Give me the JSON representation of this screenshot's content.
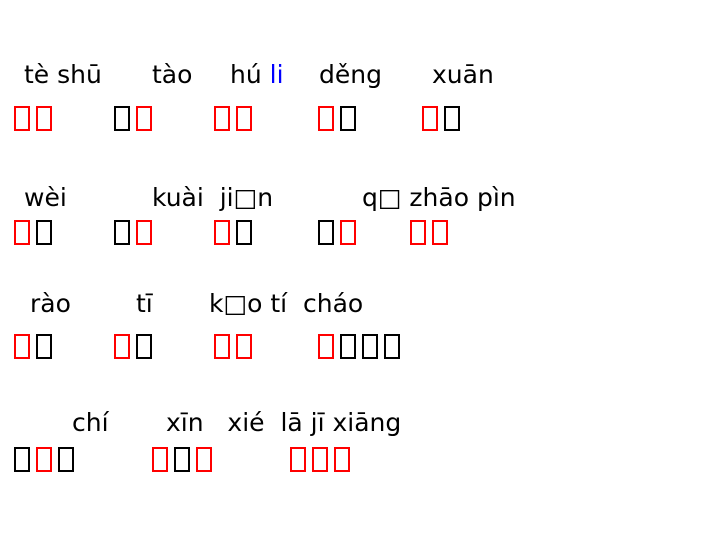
{
  "rows": [
    {
      "pinyin": [
        {
          "text": "tè shū"
        },
        {
          "text": "tào"
        },
        {
          "text": "hú ",
          "highlight": "li"
        },
        {
          "text": "děng"
        },
        {
          "text": "xuān"
        }
      ],
      "groups": [
        [
          "red",
          "red"
        ],
        [
          "black",
          "red"
        ],
        [
          "red",
          "red"
        ],
        [
          "red",
          "black"
        ],
        [
          "red",
          "black"
        ]
      ]
    },
    {
      "pinyin": [
        {
          "text": "wèi"
        },
        {
          "text": "kuài  ji□n"
        },
        {
          "text": "q□ zhāo pìn"
        }
      ],
      "groups": [
        [
          "red",
          "black"
        ],
        [
          "black",
          "red"
        ],
        [
          "red",
          "black"
        ],
        [
          "black",
          "red"
        ],
        [
          "red",
          "red"
        ]
      ]
    },
    {
      "pinyin": [
        {
          "text": "rào"
        },
        {
          "text": "tī"
        },
        {
          "text": "k□o tí  cháo"
        }
      ],
      "groups": [
        [
          "red",
          "black"
        ],
        [
          "red",
          "black"
        ],
        [
          "red",
          "red"
        ],
        [
          "red",
          "black",
          "black",
          "black"
        ]
      ]
    },
    {
      "pinyin": [
        {
          "text": "chí"
        },
        {
          "text": "xīn   xié  lā jī xiāng"
        }
      ],
      "groups": [
        [
          "black",
          "red",
          "black"
        ],
        [
          "red",
          "black",
          "red"
        ],
        [
          "red",
          "red",
          "red"
        ]
      ]
    }
  ],
  "colors": {
    "text": "#000000",
    "highlight": "#0000ff",
    "box_red": "#ff0000",
    "box_black": "#000000"
  }
}
